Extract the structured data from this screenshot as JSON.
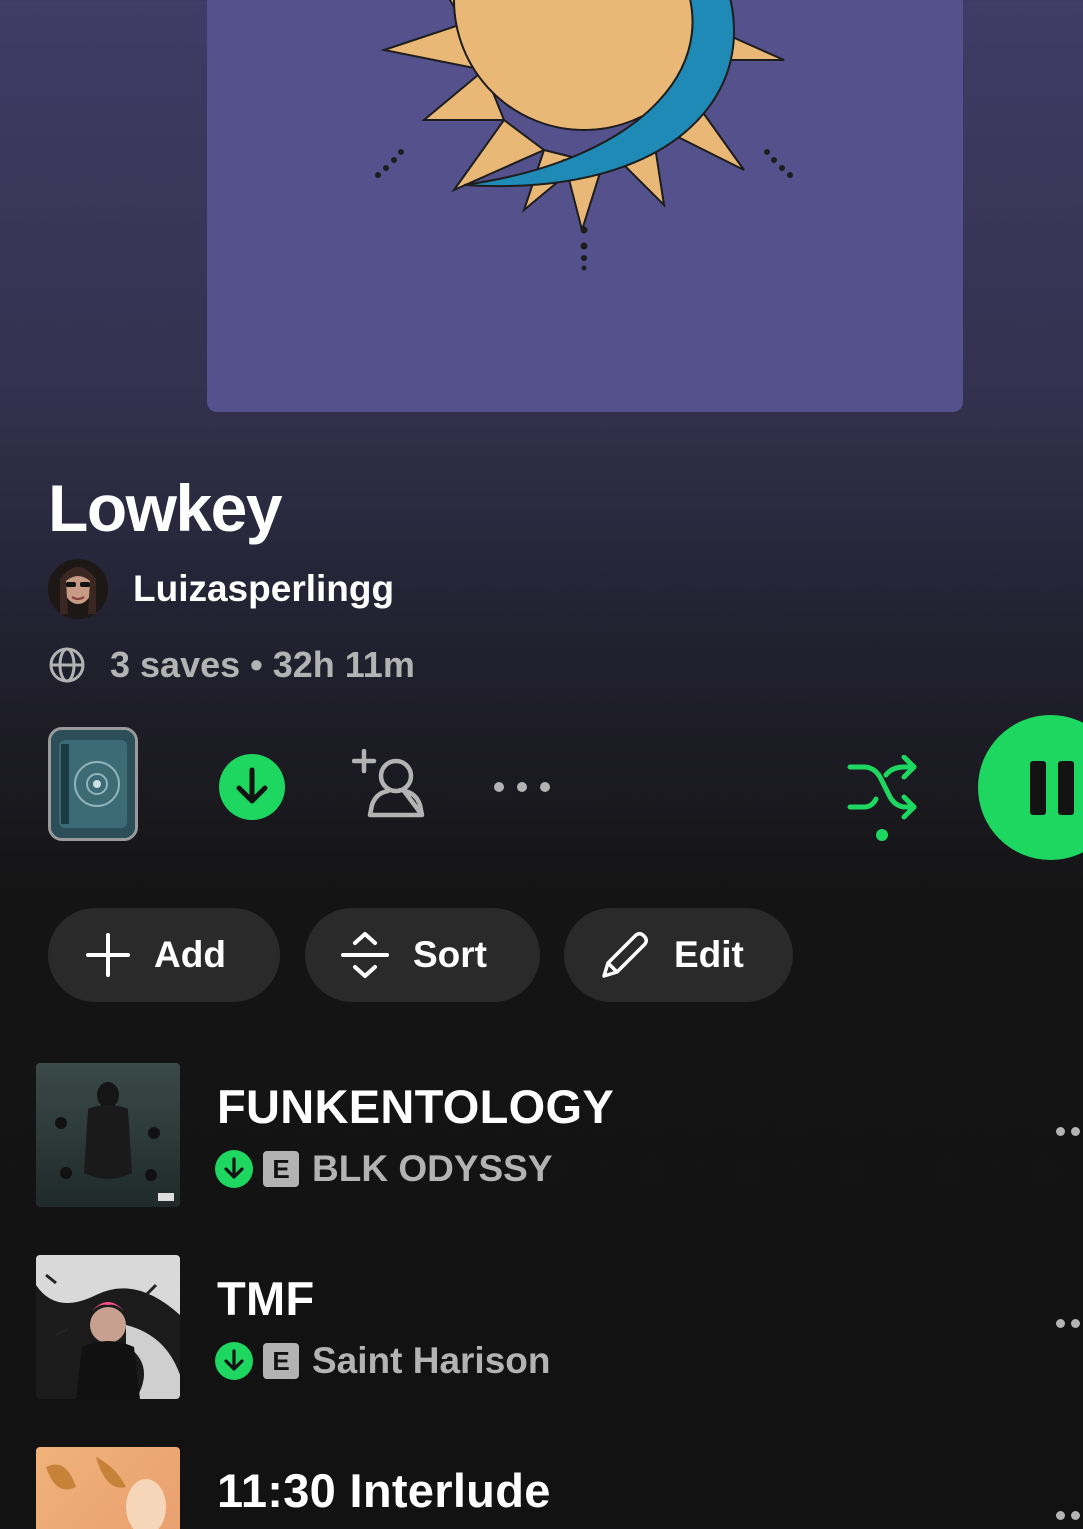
{
  "playlist": {
    "title": "Lowkey",
    "owner": "Luizasperlingg",
    "meta": "3 saves • 32h 11m"
  },
  "actions": {
    "add_label": "Add",
    "sort_label": "Sort",
    "edit_label": "Edit"
  },
  "icons": {
    "visibility": "globe-icon",
    "download": "download-icon",
    "add_collaborator": "add-user-icon",
    "more": "more-icon",
    "shuffle": "shuffle-icon",
    "pause": "pause-icon"
  },
  "colors": {
    "accent": "#1ed760",
    "cover_bg": "#54518c",
    "text_secondary": "#b3b3b3",
    "pill_bg": "#2a2a2a"
  },
  "tracks": [
    {
      "title": "FUNKENTOLOGY",
      "artist": "BLK ODYSSY",
      "downloaded": true,
      "explicit_label": "E"
    },
    {
      "title": "TMF",
      "artist": "Saint Harison",
      "downloaded": true,
      "explicit_label": "E"
    },
    {
      "title": "11:30 Interlude",
      "artist": "",
      "downloaded": false,
      "explicit_label": ""
    }
  ]
}
